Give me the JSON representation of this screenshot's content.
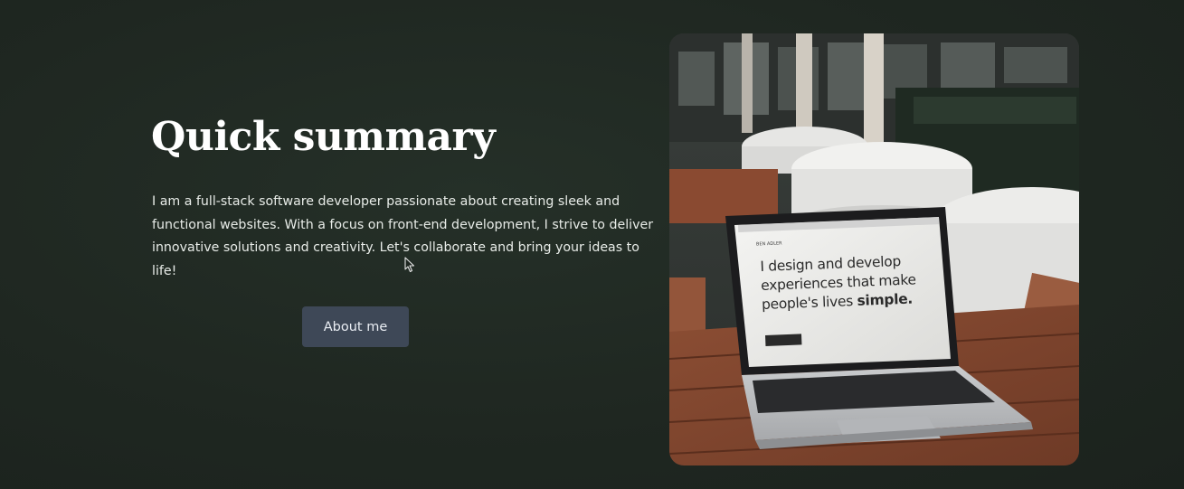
{
  "summary_section": {
    "heading": "Quick summary",
    "description": "I am a full-stack software developer passionate about creating sleek and functional websites. With a focus on front-end development, I strive to deliver innovative solutions and creativity. Let's collaborate and bring your ideas to life!",
    "about_button_label": "About me"
  },
  "photo": {
    "screen_text_line1": "I design and develop",
    "screen_text_line2": "experiences that make",
    "screen_text_line3": "people's lives",
    "screen_text_emphasis": "simple.",
    "screen_brand": "BEN ADLER"
  },
  "colors": {
    "background": "#1f2721",
    "heading": "#ffffff",
    "button_bg": "#3e4857",
    "button_text": "#e9edf3"
  },
  "icons": [
    "mouse-pointer-icon"
  ]
}
